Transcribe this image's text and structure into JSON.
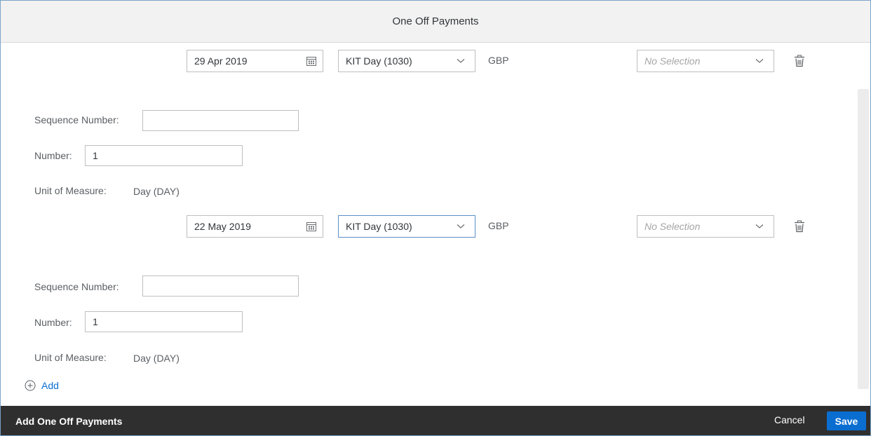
{
  "dialog": {
    "title": "One Off Payments",
    "footer_title": "Add One Off Payments",
    "cancel_label": "Cancel",
    "save_label": "Save",
    "add_label": "Add"
  },
  "payments": [
    {
      "date": "29 Apr 2019",
      "wage_type": "KIT Day (1030)",
      "currency": "GBP",
      "selection_placeholder": "No Selection",
      "sequence_label": "Sequence Number:",
      "sequence_value": "",
      "number_label": "Number:",
      "number_value": "1",
      "uom_label": "Unit of Measure:",
      "uom_value": "Day (DAY)"
    },
    {
      "date": "22 May 2019",
      "wage_type": "KIT Day (1030)",
      "currency": "GBP",
      "selection_placeholder": "No Selection",
      "sequence_label": "Sequence Number:",
      "sequence_value": "",
      "number_label": "Number:",
      "number_value": "1",
      "uom_label": "Unit of Measure:",
      "uom_value": "Day (DAY)"
    }
  ],
  "icons": {
    "calendar": "calendar-icon",
    "dropdown": "chevron-down-icon",
    "delete": "trash-icon",
    "add": "add-circle-icon"
  },
  "colors": {
    "accent": "#0a6ed1",
    "footer_bg": "#2f2f2f",
    "header_bg": "#f2f2f2"
  }
}
